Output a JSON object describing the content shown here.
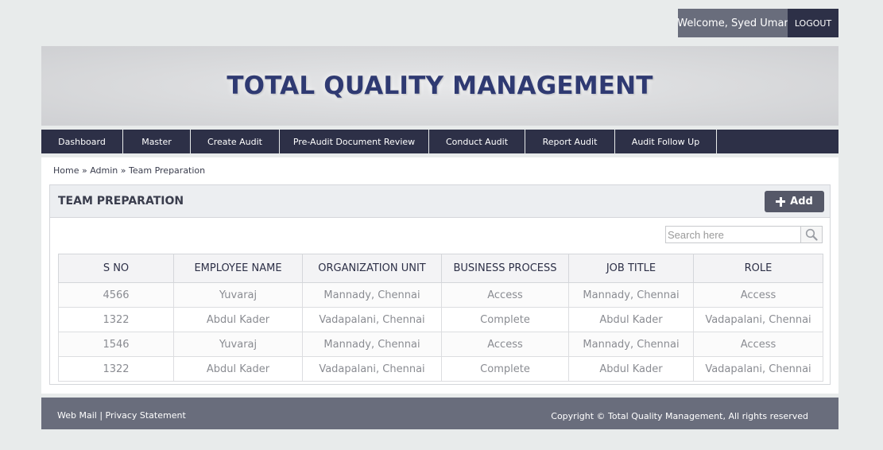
{
  "user": {
    "welcome": "Welcome, Syed Umar",
    "logout_label": "LOGOUT"
  },
  "banner": {
    "title": "TOTAL QUALITY MANAGEMENT"
  },
  "nav": {
    "items": [
      "Dashboard",
      "Master",
      "Create Audit",
      "Pre-Audit Document Review",
      "Conduct Audit",
      "Report Audit",
      "Audit Follow Up"
    ]
  },
  "breadcrumb": {
    "home": "Home",
    "separator": "»",
    "admin": "Admin",
    "current": "Team Preparation"
  },
  "card": {
    "title": "TEAM PREPARATION",
    "add_label": "Add"
  },
  "search": {
    "placeholder": "Search here"
  },
  "table": {
    "headers": [
      "S NO",
      "EMPLOYEE NAME",
      "ORGANIZATION UNIT",
      "BUSINESS PROCESS",
      "JOB TITLE",
      "ROLE"
    ],
    "rows": [
      [
        "4566",
        "Yuvaraj",
        "Mannady, Chennai",
        "Access",
        "Mannady, Chennai",
        "Access"
      ],
      [
        "1322",
        "Abdul Kader",
        "Vadapalani, Chennai",
        "Complete",
        "Abdul Kader",
        "Vadapalani, Chennai"
      ],
      [
        "1546",
        "Yuvaraj",
        "Mannady, Chennai",
        "Access",
        "Mannady, Chennai",
        "Access"
      ],
      [
        "1322",
        "Abdul Kader",
        "Vadapalani, Chennai",
        "Complete",
        "Abdul Kader",
        "Vadapalani, Chennai"
      ]
    ]
  },
  "footer": {
    "webmail": "Web Mail",
    "divider": "|",
    "privacy": "Privacy Statement",
    "copyright": "Copyright © Total Quality Management, All rights reserved"
  },
  "colors": {
    "navy": "#2d3047",
    "slate": "#696d7c",
    "title": "#2f3a72"
  }
}
